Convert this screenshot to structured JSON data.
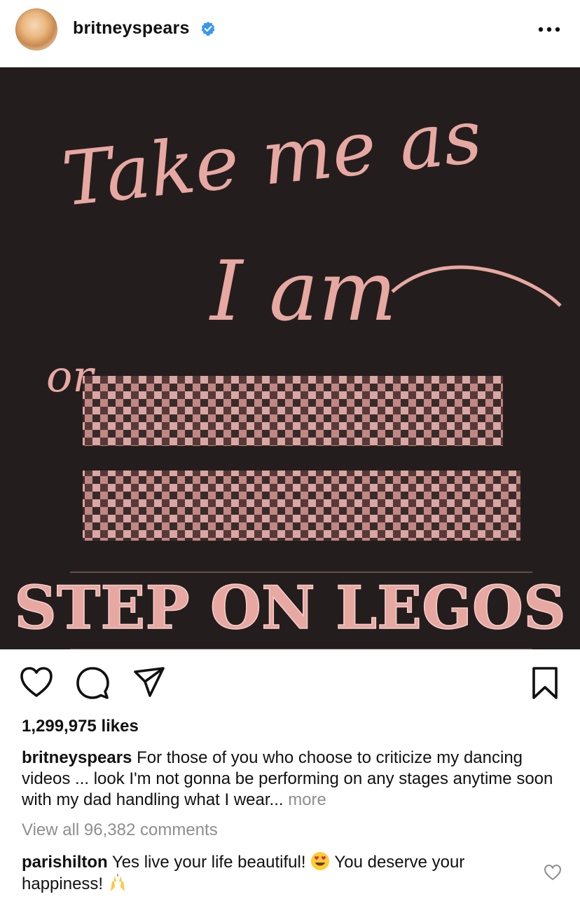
{
  "post": {
    "username": "britneyspears",
    "verified": true,
    "avatar_icon": "profile-photo",
    "more_icon": "more-horizontal-icon"
  },
  "image": {
    "line1": "Take me as",
    "line2": "I am",
    "line3": "or",
    "line4": "STEP ON LEGOS",
    "text_color": "#e8a8a2",
    "background": "#231e1d"
  },
  "actions": {
    "icons": [
      "heart-icon",
      "comment-icon",
      "share-icon",
      "bookmark-icon"
    ]
  },
  "likes": "1,299,975 likes",
  "caption": {
    "username": "britneyspears",
    "text": "For those of you who choose to criticize my dancing videos ... look I'm not gonna be performing on any stages anytime soon with my dad handling what I wear...",
    "more": "more"
  },
  "view_all": "View all 96,382 comments",
  "comment": {
    "username": "parishilton",
    "text_part1": "Yes live your life beautiful!",
    "text_part2": "You deserve your happiness!",
    "emoji1": "heart-eyes-emoji",
    "emoji2": "raising-hands-emoji"
  },
  "colors": {
    "verified_blue": "#3897f0",
    "secondary_text": "#8e8e8e"
  }
}
